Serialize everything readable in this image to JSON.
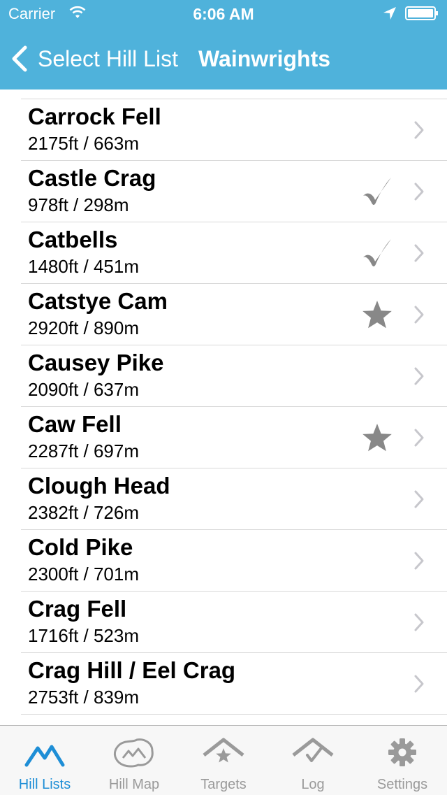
{
  "status_bar": {
    "carrier": "Carrier",
    "time": "6:06 AM"
  },
  "nav": {
    "back_label": "Select Hill List",
    "title": "Wainwrights"
  },
  "hills": [
    {
      "name": "Carrock Fell",
      "height": "2175ft / 663m",
      "status": ""
    },
    {
      "name": "Castle Crag",
      "height": "978ft / 298m",
      "status": "check"
    },
    {
      "name": "Catbells",
      "height": "1480ft / 451m",
      "status": "check"
    },
    {
      "name": "Catstye Cam",
      "height": "2920ft / 890m",
      "status": "star"
    },
    {
      "name": "Causey Pike",
      "height": "2090ft / 637m",
      "status": ""
    },
    {
      "name": "Caw Fell",
      "height": "2287ft / 697m",
      "status": "star"
    },
    {
      "name": "Clough Head",
      "height": "2382ft / 726m",
      "status": ""
    },
    {
      "name": "Cold Pike",
      "height": "2300ft / 701m",
      "status": ""
    },
    {
      "name": "Crag Fell",
      "height": "1716ft / 523m",
      "status": ""
    },
    {
      "name": "Crag Hill / Eel Crag",
      "height": "2753ft / 839m",
      "status": ""
    }
  ],
  "tabs": [
    {
      "label": "Hill Lists",
      "icon": "mountains-icon",
      "active": true
    },
    {
      "label": "Hill Map",
      "icon": "map-icon",
      "active": false
    },
    {
      "label": "Targets",
      "icon": "target-star-icon",
      "active": false
    },
    {
      "label": "Log",
      "icon": "log-check-icon",
      "active": false
    },
    {
      "label": "Settings",
      "icon": "gear-icon",
      "active": false
    }
  ],
  "colors": {
    "accent": "#4fb2db",
    "tab_active": "#1e8ed6",
    "tab_inactive": "#9a9a9a",
    "mark_gray": "#888888"
  }
}
